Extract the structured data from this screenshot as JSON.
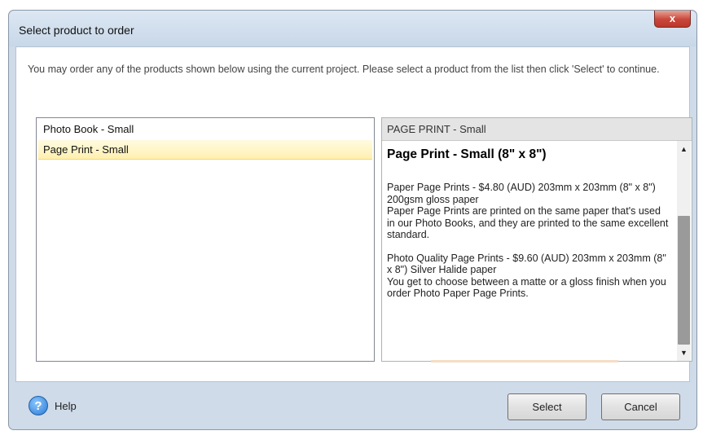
{
  "dialog": {
    "title": "Select product to order",
    "close_label": "x",
    "intro_text": "You may order any of the products shown below using the current project. Please select a product from the list then click 'Select' to continue."
  },
  "products": [
    {
      "label": "Photo Book - Small",
      "selected": false
    },
    {
      "label": "Page Print - Small",
      "selected": true
    }
  ],
  "detail": {
    "header": "PAGE PRINT - Small",
    "title": "Page Print - Small (8\" x 8\")",
    "para1_line1": "Paper Page Prints - $4.80 (AUD) 203mm x 203mm (8\" x 8\") 200gsm gloss paper",
    "para1_line2": "Paper Page Prints are printed on the same paper that's used in our Photo Books, and they are printed to the same excellent standard.",
    "para2_line1": "Photo Quality Page Prints - $9.60 (AUD) 203mm x 203mm (8\" x 8\") Silver Halide paper",
    "para2_line2": "You get to choose between a matte or a gloss finish when you order Photo Paper Page Prints."
  },
  "scrollbar": {
    "up_glyph": "▲",
    "down_glyph": "▼"
  },
  "footer": {
    "help_icon_glyph": "?",
    "help_label": "Help",
    "select_label": "Select",
    "cancel_label": "Cancel"
  }
}
